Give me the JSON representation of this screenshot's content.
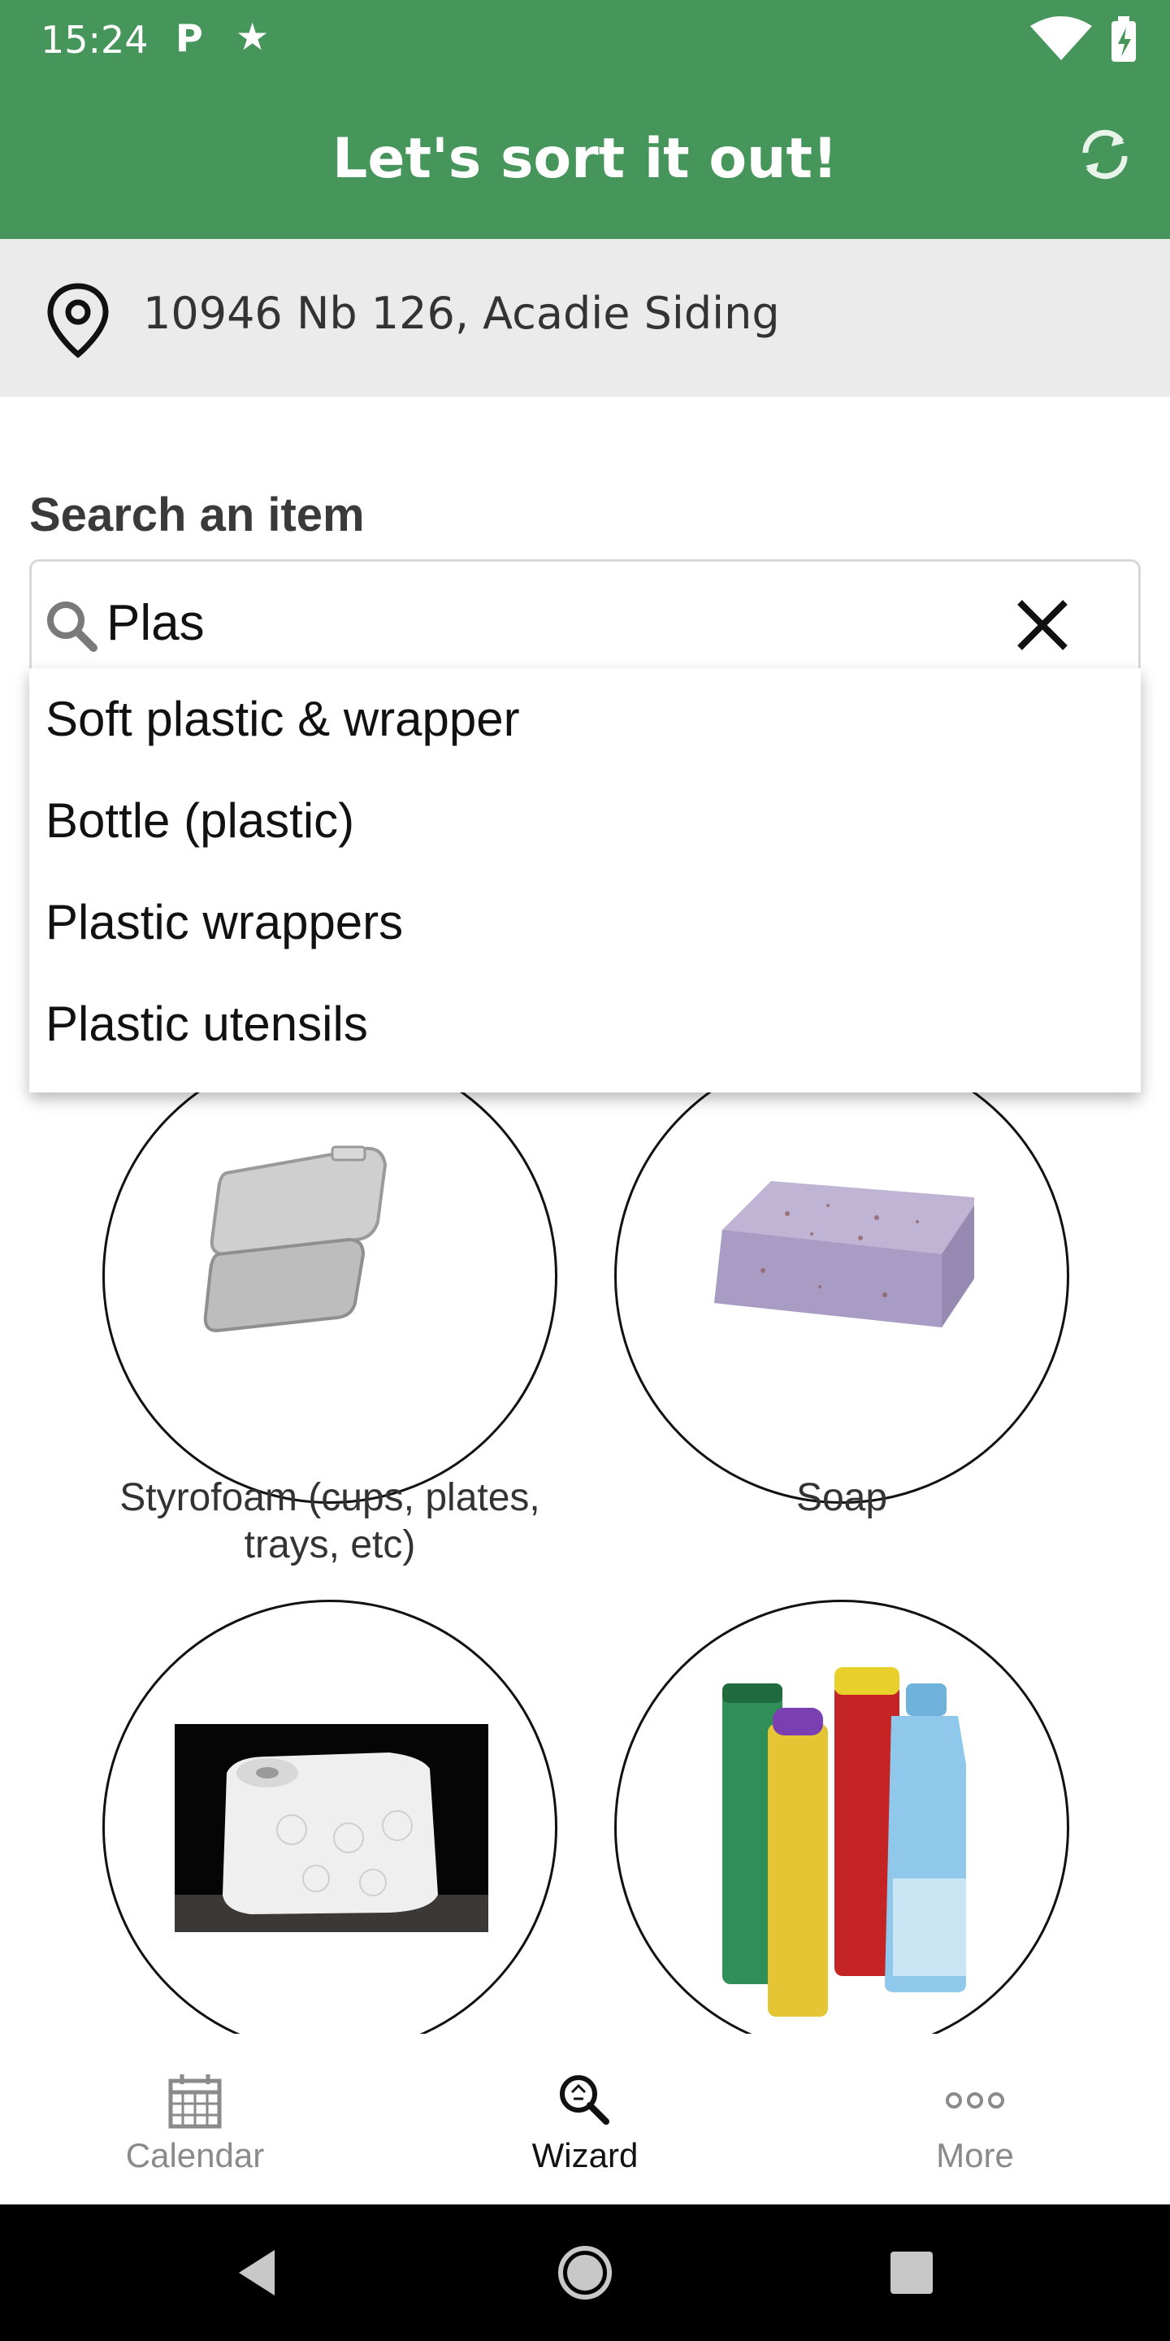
{
  "status_bar": {
    "time": "15:24",
    "left_icons": [
      "parking-icon",
      "star-icon"
    ],
    "right_icons": [
      "wifi-icon",
      "battery-charging-icon"
    ]
  },
  "app_bar": {
    "title": "Let's sort it out!",
    "action_icon": "refresh-icon",
    "color": "#46955a"
  },
  "address": {
    "icon": "location-pin-icon",
    "text": "10946 Nb 126, Acadie Siding"
  },
  "search": {
    "label": "Search an item",
    "value": "Plas",
    "suggestions": [
      "Soft plastic & wrapper",
      "Bottle (plastic)",
      "Plastic wrappers",
      "Plastic utensils"
    ]
  },
  "items": [
    {
      "label": "Styrofoam (cups, plates, trays, etc)",
      "image": "styrofoam-container"
    },
    {
      "label": "Soap",
      "image": "soap-bar"
    },
    {
      "label": "",
      "image": "paper-towel-roll"
    },
    {
      "label": "",
      "image": "aerosol-cans"
    }
  ],
  "bottom_nav": {
    "items": [
      {
        "label": "Calendar",
        "icon": "calendar-icon",
        "active": false
      },
      {
        "label": "Wizard",
        "icon": "wizard-search-icon",
        "active": true
      },
      {
        "label": "More",
        "icon": "more-dots-icon",
        "active": false
      }
    ]
  },
  "system_nav": [
    "back-icon",
    "home-icon",
    "recents-icon"
  ]
}
